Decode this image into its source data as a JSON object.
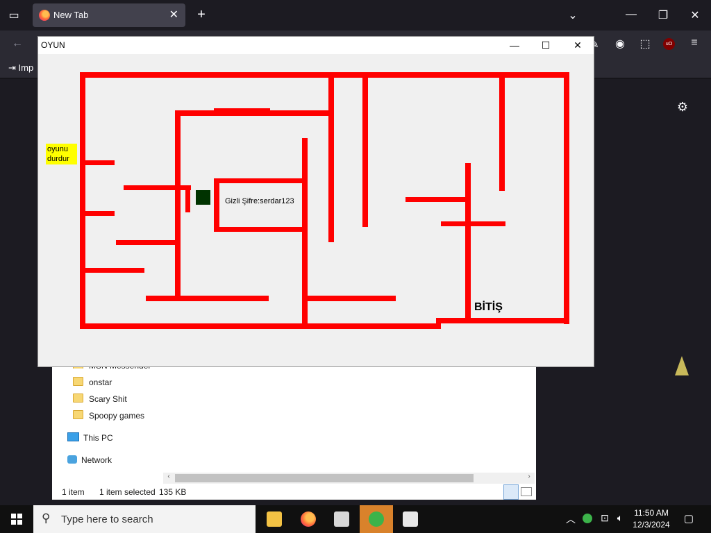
{
  "browser": {
    "tab_title": "New Tab",
    "bookmark_label": "Imp"
  },
  "explorer": {
    "items": [
      {
        "label": "MSN Messenger"
      },
      {
        "label": "onstar"
      },
      {
        "label": "Scary Shit"
      },
      {
        "label": "Spoopy games"
      }
    ],
    "this_pc": "This PC",
    "network": "Network",
    "status": {
      "count": "1 item",
      "selected": "1 item selected",
      "size": "135 KB"
    }
  },
  "game": {
    "window_title": "OYUN",
    "pause_button": "oyunu durdur",
    "secret_text": "Gizli Şifre:serdar123",
    "finish_label": "BİTİŞ",
    "wall_color": "#ff0000",
    "player_color": "#003300"
  },
  "taskbar": {
    "search_placeholder": "Type here to search",
    "time": "11:50 AM",
    "date": "12/3/2024"
  }
}
